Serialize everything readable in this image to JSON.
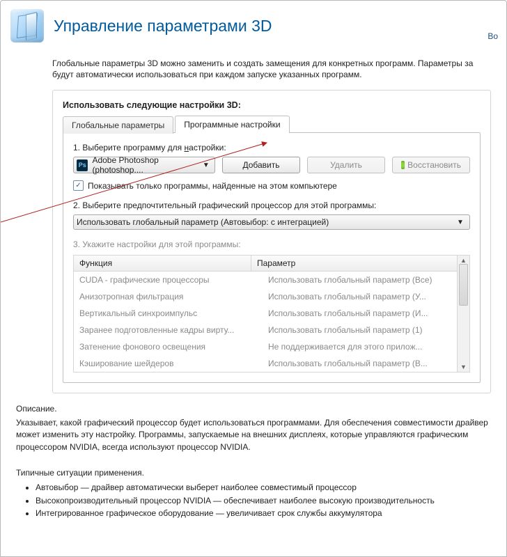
{
  "header": {
    "title": "Управление параметрами 3D",
    "right_link": "Во"
  },
  "intro": {
    "line1": "Глобальные параметры 3D можно заменить и создать замещения для конкретных программ. Параметры за",
    "line2": "будут автоматически использоваться при каждом запуске указанных программ."
  },
  "group": {
    "title": "Использовать следующие настройки 3D:",
    "tabs": {
      "global": "Глобальные параметры",
      "program": "Программные настройки"
    },
    "step1": {
      "label_prefix": "1. Выберите программу для ",
      "label_underlined": "н",
      "label_suffix": "астройки:",
      "select_value": "Adobe Photoshop (photoshop....",
      "select_icon_text": "Ps",
      "add_btn": "Добавить",
      "del_btn": "Удалить",
      "restore_btn": "Восстановить",
      "checkbox_label": "Показывать только программы, найденные на этом компьютере"
    },
    "step2": {
      "label": "2. Выберите предпочтительный графический процессор для этой программы:",
      "select_value": "Использовать глобальный параметр (Автовыбор: с интеграцией)"
    },
    "step3": {
      "label": "3. Укажите настройки для этой программы:",
      "cols": {
        "func": "Функция",
        "param": "Параметр"
      },
      "rows": [
        {
          "func": "CUDA - графические процессоры",
          "param": "Использовать глобальный параметр (Все)"
        },
        {
          "func": "Анизотропная фильтрация",
          "param": "Использовать глобальный параметр (У..."
        },
        {
          "func": "Вертикальный синхроимпульс",
          "param": "Использовать глобальный параметр (И..."
        },
        {
          "func": "Заранее подготовленные кадры вирту...",
          "param": "Использовать глобальный параметр (1)"
        },
        {
          "func": "Затенение фонового освещения",
          "param": "Не поддерживается для этого прилож..."
        },
        {
          "func": "Кэширование шейдеров",
          "param": "Использовать глобальный параметр (В..."
        }
      ]
    }
  },
  "description": {
    "heading": "Описание.",
    "body": "Указывает, какой графический процессор будет использоваться программами. Для обеспечения совместимости драйвер может изменить эту настройку. Программы, запускаемые на внешних дисплеях, которые управляются графическим процессором NVIDIA, всегда используют процессор NVIDIA."
  },
  "usecases": {
    "heading": "Типичные ситуации применения.",
    "items": [
      "Автовыбор — драйвер автоматически выберет наиболее совместимый процессор",
      "Высокопроизводительный процессор NVIDIA — обеспечивает наиболее высокую производительность",
      "Интегрированное графическое оборудование — увеличивает срок службы аккумулятора"
    ]
  }
}
